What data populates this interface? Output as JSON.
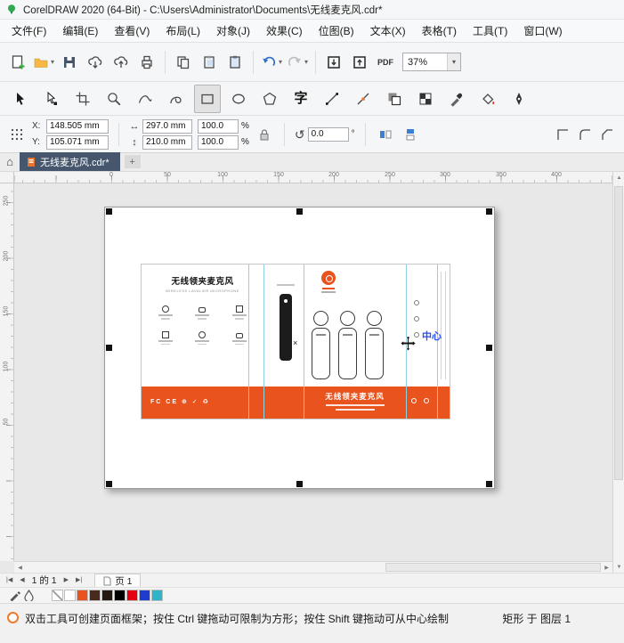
{
  "colors": {
    "accent_orange": "#e8531e",
    "snap_blue": "#2a4df0",
    "dieline_cyan": "#8ed2e2",
    "active_tab_bg": "#46566c"
  },
  "titlebar": {
    "title": "CorelDRAW 2020 (64-Bit) - C:\\Users\\Administrator\\Documents\\无线麦克风.cdr*"
  },
  "menubar": {
    "items": [
      {
        "label": "文件(F)"
      },
      {
        "label": "编辑(E)"
      },
      {
        "label": "查看(V)"
      },
      {
        "label": "布局(L)"
      },
      {
        "label": "对象(J)"
      },
      {
        "label": "效果(C)"
      },
      {
        "label": "位图(B)"
      },
      {
        "label": "文本(X)"
      },
      {
        "label": "表格(T)"
      },
      {
        "label": "工具(T)"
      },
      {
        "label": "窗口(W)"
      }
    ]
  },
  "toolbar": {
    "pdf_label": "PDF",
    "zoom_value": "37%"
  },
  "toolbox": {
    "text_tool_glyph": "字"
  },
  "propbar": {
    "x_label": "X:",
    "x_value": "148.505 mm",
    "y_label": "Y:",
    "y_value": "105.071 mm",
    "width_value": "297.0 mm",
    "height_value": "210.0 mm",
    "scale_x_value": "100.0",
    "scale_y_value": "100.0",
    "percent": "%",
    "rotation_value": "0.0",
    "degree": "°"
  },
  "doctabs": {
    "home_glyph": "⌂",
    "active_label": "无线麦克风.cdr*",
    "new_tab_label": "+"
  },
  "rulers": {
    "h": [
      "0",
      "50",
      "100",
      "150",
      "200",
      "250",
      "300",
      "350",
      "400"
    ],
    "v": [
      "250",
      "200",
      "150",
      "100",
      "50"
    ]
  },
  "artwork": {
    "panel1_title": "无线领夹麦克风",
    "panel1_subtitle": "WIRELESS LAVALIER MICROPHONE",
    "band_title": "无线领夹麦克风",
    "cert_marks": "FC CE ⊕ ✓ ♻",
    "close_mark": "×",
    "snap_label": "中心"
  },
  "pagenav": {
    "first": "|◀",
    "prev": "◀",
    "counter": "1 的 1",
    "next": "▶",
    "last": "▶|",
    "page_tab_label": "页 1"
  },
  "palette": {
    "swatches": [
      "none",
      "#ffffff",
      "#e8531e",
      "#4a2a1c",
      "#241812",
      "#000000",
      "#e60012",
      "#1f3bd0",
      "#2fb3c9"
    ]
  },
  "statusbar": {
    "hint": "双击工具可创建页面框架；按住 Ctrl 键拖动可限制为方形；按住 Shift 键拖动可从中心绘制",
    "object_info": "矩形 于 图层 1"
  }
}
